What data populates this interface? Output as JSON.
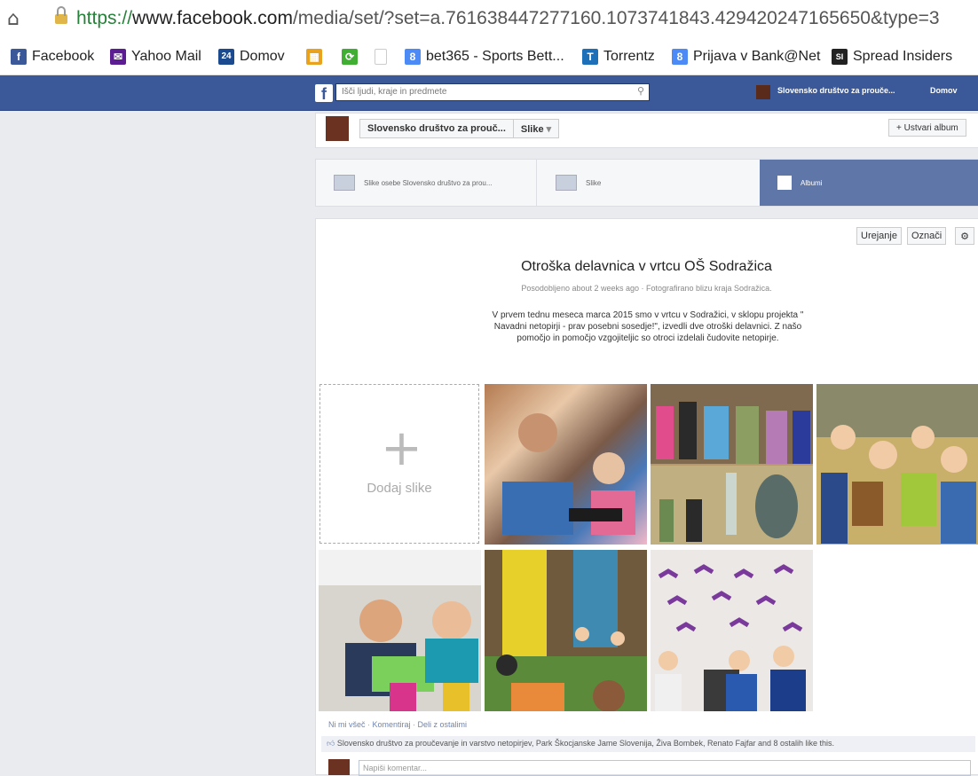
{
  "browser": {
    "url_proto": "https://",
    "url_domain": "www.facebook.com",
    "url_path": "/media/set/?set=a.761638447277160.1073741843.429420247165650&type=3"
  },
  "bookmarks": [
    {
      "label": "Facebook",
      "color": "#3b5998",
      "glyph": "f"
    },
    {
      "label": "Yahoo Mail",
      "color": "#5c1d93",
      "glyph": "✉"
    },
    {
      "label": "Domov",
      "color": "#1c4a8f",
      "glyph": "24"
    },
    {
      "label": "",
      "color": "#e8a21d",
      "glyph": "▦"
    },
    {
      "label": "",
      "color": "#3fae33",
      "glyph": "⟳"
    },
    {
      "label": "",
      "color": "#ffffff",
      "glyph": "🗋"
    },
    {
      "label": "bet365 - Sports Bett...",
      "color": "#4c8bf5",
      "glyph": "8"
    },
    {
      "label": "Torrentz",
      "color": "#1d6fb7",
      "glyph": "T"
    },
    {
      "label": "Prijava v Bank@Net",
      "color": "#4c8bf5",
      "glyph": "8"
    },
    {
      "label": "Spread Insiders",
      "color": "#222222",
      "glyph": "SI"
    }
  ],
  "fb": {
    "search_placeholder": "Išči ljudi, kraje in predmete",
    "nav_name": "Slovensko društvo za prouče...",
    "nav_home": "Domov"
  },
  "album_header": {
    "select_name": "Slovensko društvo za prouč...",
    "select_type": "Slike",
    "create": "+ Ustvari album"
  },
  "tabs": [
    {
      "label": "Slike osebe Slovensko društvo za prou..."
    },
    {
      "label": "Slike"
    },
    {
      "label": "Albumi"
    }
  ],
  "album": {
    "edit": "Urejanje",
    "tag": "Označi",
    "title": "Otroška delavnica v vrtcu OŠ Sodražica",
    "meta": "Posodobljeno about 2 weeks ago · Fotografirano blizu kraja Sodražica.",
    "description": "V prvem tednu meseca marca 2015 smo v vrtcu v Sodražici, v sklopu projekta \" Navadni netopirji - prav posebni sosedje!\", izvedli dve otroški delavnici. Z našo pomočjo in pomočjo vzgojiteljic so otroci izdelali čudovite netopirje.",
    "add_photos": "Dodaj slike"
  },
  "footer": {
    "like": "Ni mi všeč",
    "comment": "Komentiraj",
    "share": "Deli z ostalimi",
    "likes_text": "Slovensko društvo za proučevanje in varstvo netopirjev, Park Škocjanske Jame Slovenija, Živa Bombek, Renato Fajfar and 8 ostalih like this.",
    "comment_placeholder": "Napiši komentar..."
  }
}
